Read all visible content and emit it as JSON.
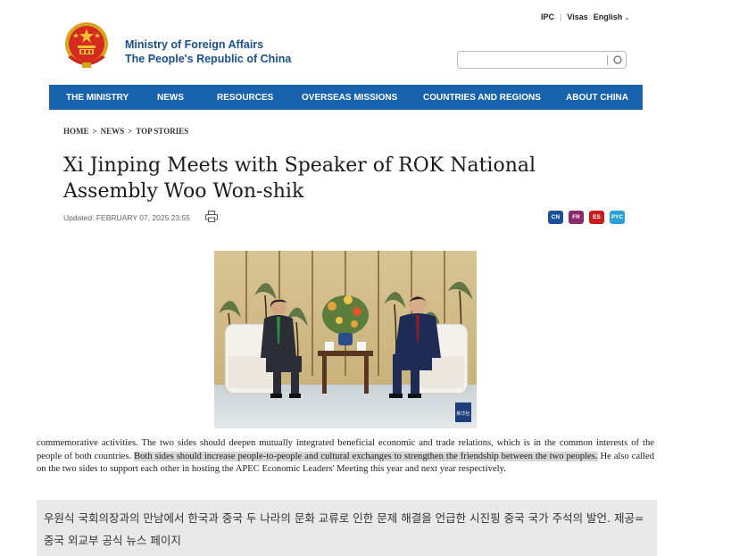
{
  "header": {
    "top_links": {
      "ipc": "IPC",
      "visas": "Visas",
      "language": "English"
    },
    "org_line1": "Ministry of Foreign Affairs",
    "org_line2": "The People's Republic of China",
    "search": {
      "placeholder": ""
    }
  },
  "nav": {
    "items": [
      "THE MINISTRY",
      "NEWS",
      "RESOURCES",
      "OVERSEAS MISSIONS",
      "COUNTRIES AND REGIONS",
      "ABOUT CHINA"
    ]
  },
  "breadcrumb": {
    "home": "HOME",
    "sep": ">",
    "news": "NEWS",
    "current": "TOP STORIES"
  },
  "article": {
    "title": "Xi Jinping Meets with Speaker of ROK National Assembly Woo Won-shik",
    "updated": "Updated: FEBRUARY 07, 2025 23:55",
    "languages": [
      {
        "code": "CN",
        "color": "#1d4f9a"
      },
      {
        "code": "FR",
        "color": "#8b2a6b"
      },
      {
        "code": "ES",
        "color": "#c81e1e"
      },
      {
        "code": "PYC",
        "color": "#2aa0d6"
      }
    ],
    "photo_watermark": "新华社",
    "body_part1": "commemorative activities. The two sides should deepen mutually integrated beneficial economic and trade relations, which is in the common interests of the people of both countries. ",
    "body_highlight": "Both sides should increase people-to-people and cultural exchanges to strengthen the friendship between the two peoples.",
    "body_part2": " He also called on the two sides to support each other in hosting the APEC Economic Leaders' Meeting this year and next year respectively."
  },
  "caption": {
    "text": "우원식 국회의장과의 만남에서 한국과 중국 두 나라의 문화 교류로 인한 문제 해결을 언급한 시진핑 중국 국가 주석의 발언. 제공=중국 외교부 공식 뉴스 페이지"
  },
  "colors": {
    "nav_bg": "#1862ac",
    "brand_text": "#1a4f8f",
    "caption_bg": "#e9e9e9",
    "highlight": "#d6d6d6"
  }
}
